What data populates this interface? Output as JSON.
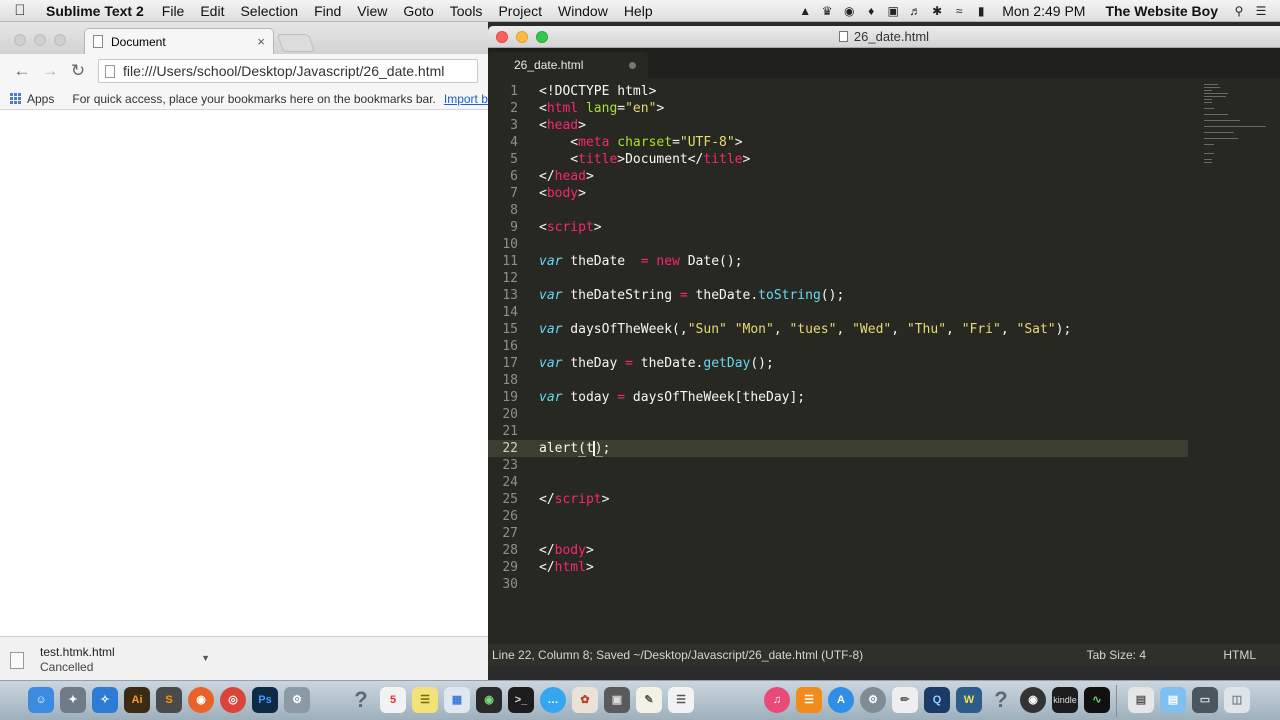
{
  "menubar": {
    "app_name": "Sublime Text 2",
    "items": [
      "File",
      "Edit",
      "Selection",
      "Find",
      "View",
      "Goto",
      "Tools",
      "Project",
      "Window",
      "Help"
    ],
    "clock": "Mon 2:49 PM",
    "user": "The Website Boy"
  },
  "browser": {
    "tab_title": "Document",
    "tab_close": "×",
    "back": "←",
    "forward": "→",
    "reload": "↻",
    "url": "file:///Users/school/Desktop/Javascript/26_date.html",
    "apps_label": "Apps",
    "bookmarks_hint": "For quick access, place your bookmarks here on the bookmarks bar.",
    "import_link": "Import b",
    "download_name": "test.htmk.html",
    "download_status": "Cancelled"
  },
  "sublime": {
    "window_title": "26_date.html",
    "tab_label": "26_date.html",
    "status_text": "Line 22, Column 8; Saved ~/Desktop/Javascript/26_date.html (UTF-8)",
    "tab_size": "Tab Size: 4",
    "syntax": "HTML",
    "active_line": 22,
    "line_numbers": [
      "1",
      "2",
      "3",
      "4",
      "5",
      "6",
      "7",
      "8",
      "9",
      "10",
      "11",
      "12",
      "13",
      "14",
      "15",
      "16",
      "17",
      "18",
      "19",
      "20",
      "21",
      "22",
      "23",
      "24",
      "25",
      "26",
      "27",
      "28",
      "29",
      "30"
    ]
  },
  "colors": {
    "editor_bg": "#272822",
    "tag": "#f92672",
    "attribute": "#a6e22e",
    "string": "#e6db74",
    "keyword": "#66d9ef"
  },
  "dock": {
    "icons": [
      "finder-icon",
      "launchpad-icon",
      "safari-icon",
      "illustrator-icon",
      "sublime-text-icon",
      "firefox-icon",
      "chrome-icon",
      "photoshop-icon",
      "system-preferences-icon",
      "help-icon",
      "calendar-icon",
      "notes-icon",
      "preview-icon",
      "photo-booth-icon",
      "terminal-icon",
      "messages-icon",
      "photos-icon",
      "app-icon",
      "textedit-icon",
      "itunes-icon",
      "ibooks-icon",
      "app-store-icon",
      "settings-icon",
      "script-icon",
      "quicktime-icon",
      "dreamweaver-icon",
      "help-icon",
      "github-icon",
      "kindle-icon",
      "activity-monitor-icon",
      "downloads-icon",
      "folder-icon",
      "screen-icon",
      "trash-icon"
    ],
    "kindle_label": "kindle"
  }
}
